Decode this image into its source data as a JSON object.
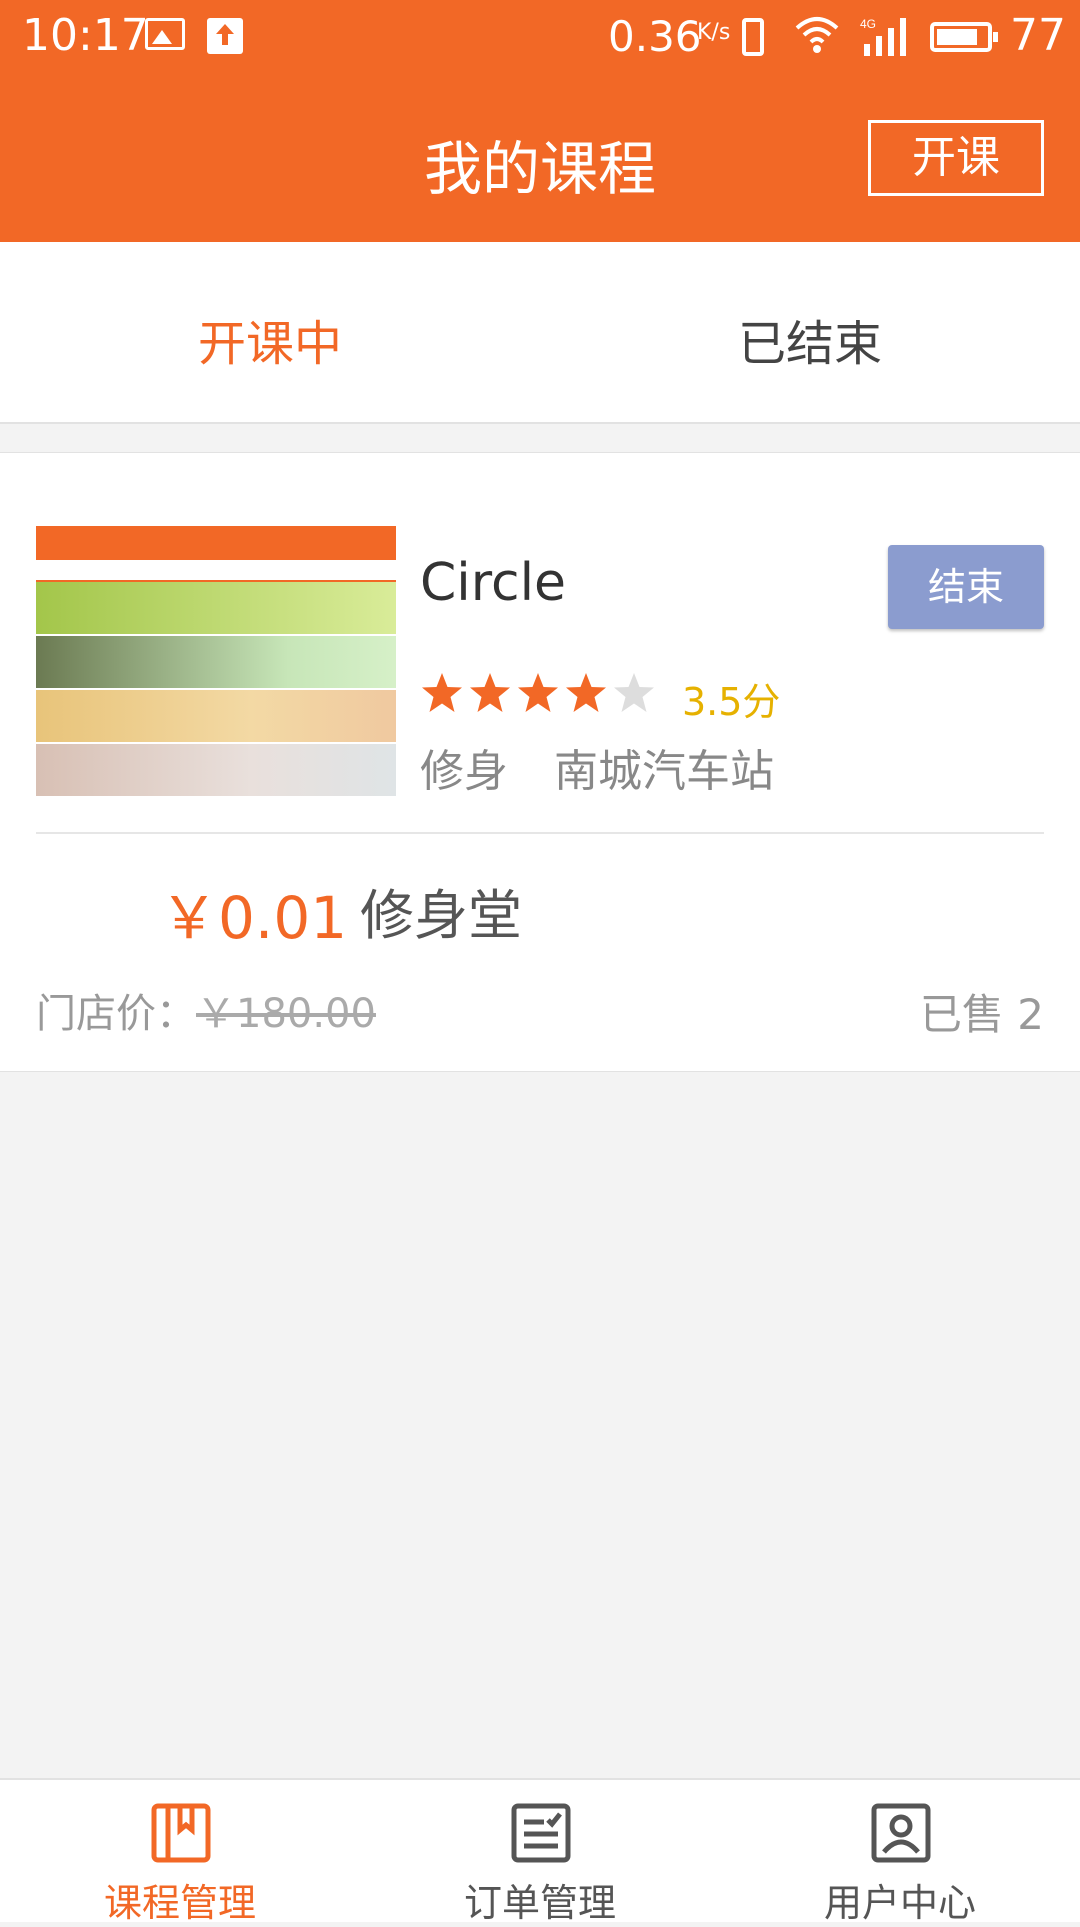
{
  "status_bar": {
    "time": "10:17",
    "net_speed": "0.36",
    "net_speed_unit": "K/s",
    "battery_level": "77",
    "icons": [
      "image-icon",
      "upload-icon",
      "vibrate-icon",
      "wifi-icon",
      "4g-signal-icon",
      "battery-icon"
    ]
  },
  "header": {
    "title": "我的课程",
    "open_button": "开课"
  },
  "tabs": {
    "active": "开课中",
    "ended": "已结束"
  },
  "course": {
    "name": "Circle",
    "end_button": "结束",
    "rating": 3.5,
    "rating_max": 5,
    "score_text": "3.5分",
    "category": "修身",
    "location": "南城汽车站",
    "price": "￥0.01",
    "shop_name": "修身堂",
    "store_price_label": "门店价：",
    "store_price": "￥180.00",
    "sold": "已售 2"
  },
  "bottom_nav": {
    "items": [
      {
        "label": "课程管理",
        "icon": "course-book-icon",
        "active": true
      },
      {
        "label": "订单管理",
        "icon": "order-list-icon",
        "active": false
      },
      {
        "label": "用户中心",
        "icon": "user-icon",
        "active": false
      }
    ]
  },
  "colors": {
    "brand": "#f26826",
    "end_button": "#8b9ccf",
    "score": "#e6b100",
    "star_empty": "#dddddd"
  }
}
